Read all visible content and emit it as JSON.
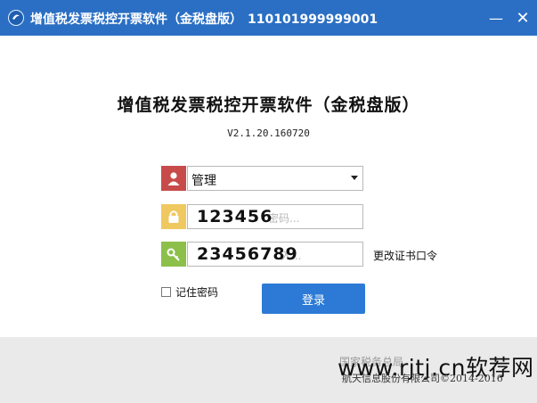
{
  "window": {
    "title": "增值税发票税控开票软件（金税盘版）",
    "serial": "110101999999001",
    "minimize_glyph": "—",
    "close_glyph": "✕"
  },
  "app": {
    "title": "增值税发票税控开票软件（金税盘版）",
    "version": "V2.1.20.160720"
  },
  "form": {
    "user_select_value": "管理",
    "password_placeholder": "密码...",
    "password_value": "123456",
    "cert_placeholder": "入...",
    "cert_value": "23456789",
    "change_cert_link": "更改证书口令",
    "remember_label": "记住密码",
    "login_label": "登录"
  },
  "footer": {
    "link_text": "国家税务总局",
    "copyright": "航天信息股份有限公司©2014-2016"
  },
  "watermark": "www.rjtj.cn软荐网",
  "colors": {
    "titlebar": "#2b6fc4",
    "login_button": "#2d7ad6",
    "user_icon_bg": "#c84b4b",
    "lock_icon_bg": "#f0c860",
    "key_icon_bg": "#8cc04a"
  },
  "icons": [
    "app-logo-icon",
    "user-icon",
    "lock-icon",
    "key-icon",
    "dropdown-arrow-icon",
    "minimize-icon",
    "close-icon"
  ]
}
